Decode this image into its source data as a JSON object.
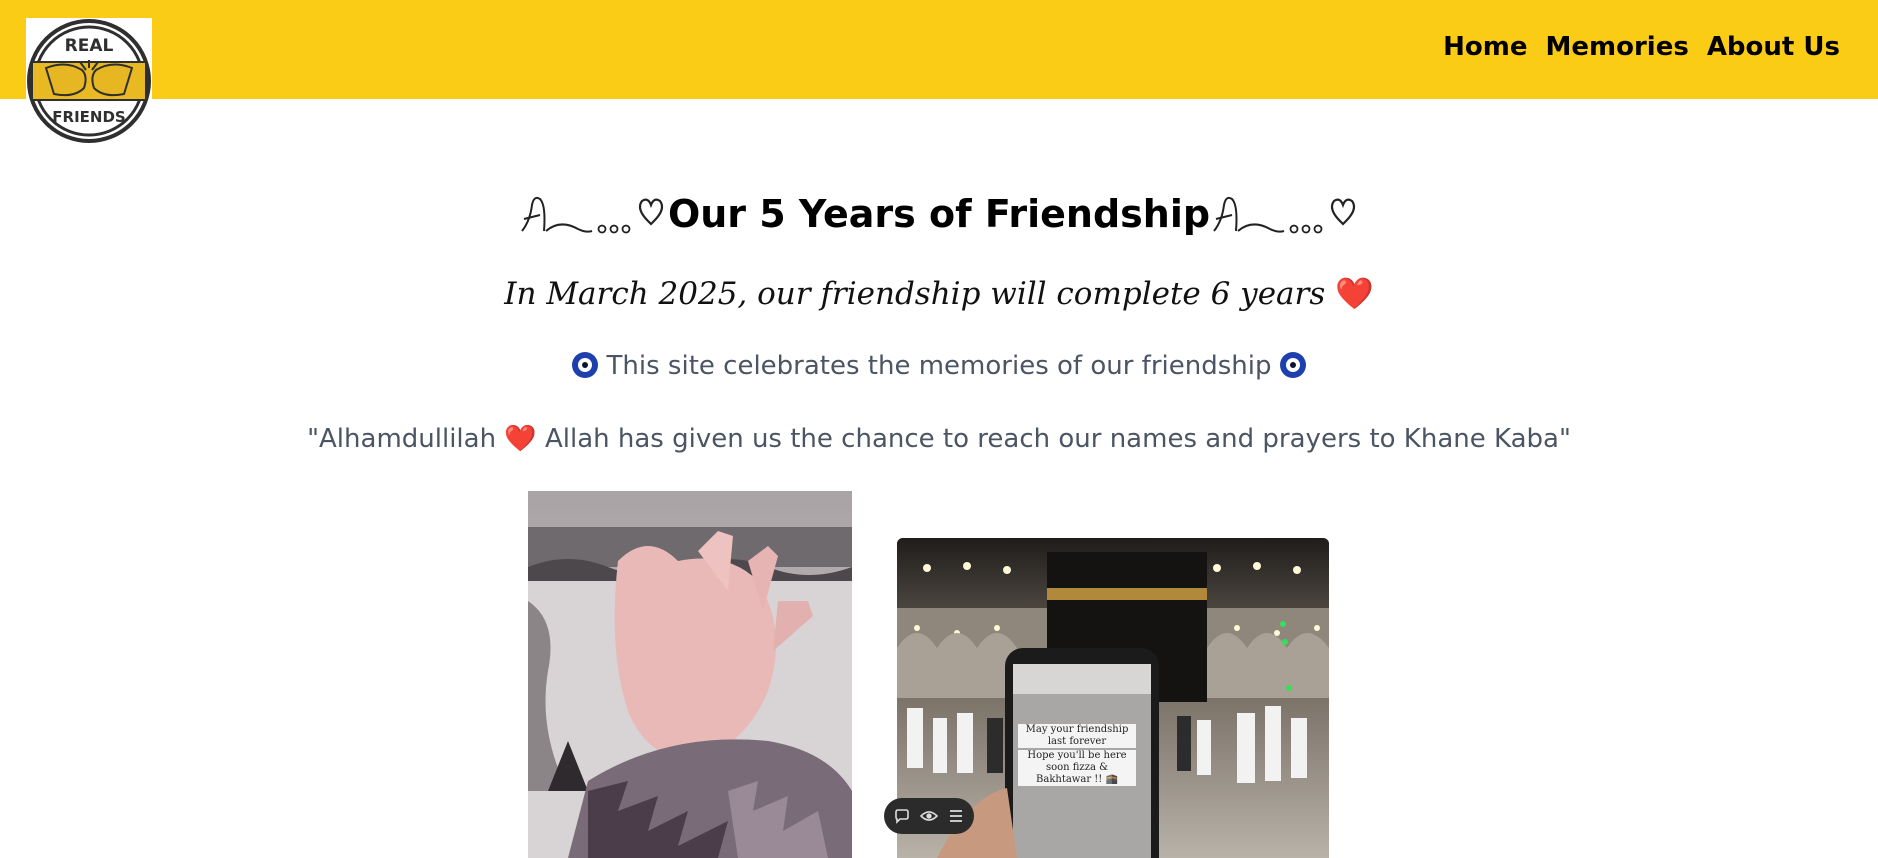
{
  "header": {
    "logo": {
      "top_text": "REAL",
      "bottom_text": "FRIENDS",
      "icon": "fist-bump-icon"
    },
    "nav": [
      {
        "label": "Home"
      },
      {
        "label": "Memories"
      },
      {
        "label": "About Us"
      }
    ]
  },
  "hero": {
    "title_prefix_ornament": "ribbon-heart-ornament",
    "title": "Our 5 Years of Friendship",
    "title_suffix_ornament": "ribbon-heart-ornament",
    "subtitle": "In March 2025, our friendship will complete 6 years",
    "subtitle_emoji": "❤️",
    "tagline": "This site celebrates the memories of our friendship",
    "tagline_icon": "evil-eye-icon",
    "quote_open": "\"Alhamdullilah",
    "quote_emoji": "❤️",
    "quote_close": "Allah has given us the chance to reach our names and prayers to Khane Kaba\""
  },
  "photos": {
    "right_overlay": {
      "line1": "May your friendship last forever",
      "line2": "Hope you'll be here soon fizza & Bakhtawar !! 🕋"
    }
  },
  "toolbar": {
    "icons": [
      "comment-icon",
      "eye-icon",
      "menu-icon"
    ]
  },
  "colors": {
    "header_bg": "#facc15",
    "heart": "#e11d2e",
    "muted_text": "#4b5563"
  }
}
